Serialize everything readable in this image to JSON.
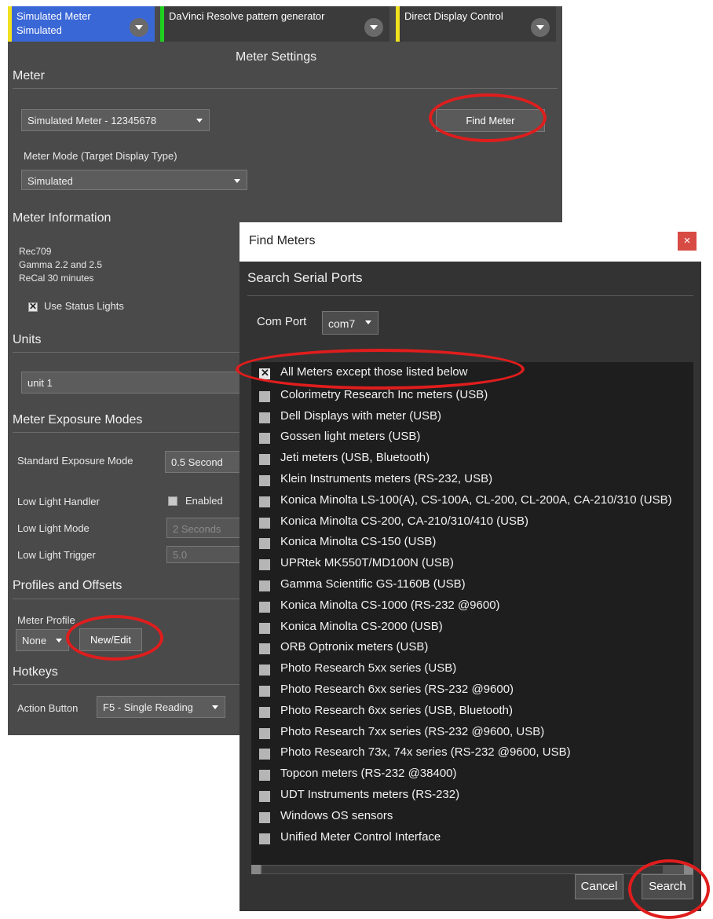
{
  "tabs": [
    {
      "label_line1": "Simulated Meter",
      "label_line2": "Simulated",
      "accent": "#f0e020",
      "bg": "#3a67d6"
    },
    {
      "label_line1": "DaVinci Resolve pattern generator",
      "label_line2": "",
      "accent": "#1fd11f",
      "bg": "#3b3b3b"
    },
    {
      "label_line1": "Direct Display Control",
      "label_line2": "",
      "accent": "#f0e020",
      "bg": "#3b3b3b"
    }
  ],
  "panel": {
    "title": "Meter Settings",
    "meter_header": "Meter",
    "meter_select": "Simulated Meter - 12345678",
    "find_meter": "Find Meter",
    "mode_label": "Meter Mode (Target Display Type)",
    "mode_select": "Simulated",
    "info_header": "Meter Information",
    "info_lines": [
      "Rec709",
      "Gamma 2.2 and 2.5",
      "ReCal 30 minutes"
    ],
    "status_lights": "Use Status Lights",
    "units_header": "Units",
    "unit_select": "unit 1",
    "exposure_header": "Meter Exposure Modes",
    "std_exposure_label": "Standard Exposure Mode",
    "std_exposure_value": "0.5 Second",
    "low_light_handler_label": "Low Light Handler",
    "enabled_label": "Enabled",
    "low_light_mode_label": "Low Light Mode",
    "low_light_mode_value": "2 Seconds",
    "low_light_trigger_label": "Low Light Trigger",
    "low_light_trigger_value": "5.0",
    "profiles_header": "Profiles and Offsets",
    "meter_profile_label": "Meter Profile",
    "profile_select": "None",
    "new_edit": "New/Edit",
    "hotkeys_header": "Hotkeys",
    "action_button_label": "Action Button",
    "action_select": "F5 - Single Reading"
  },
  "dialog": {
    "title": "Find Meters",
    "close": "×",
    "section": "Search Serial Ports",
    "com_port_label": "Com Port",
    "com_port_value": "com7",
    "meters": [
      {
        "label": "All Meters except those listed below",
        "checked": true
      },
      {
        "label": "Colorimetry Research Inc meters (USB)",
        "checked": false
      },
      {
        "label": "Dell Displays with meter (USB)",
        "checked": false
      },
      {
        "label": "Gossen light meters (USB)",
        "checked": false
      },
      {
        "label": "Jeti meters (USB, Bluetooth)",
        "checked": false
      },
      {
        "label": "Klein Instruments meters (RS-232, USB)",
        "checked": false
      },
      {
        "label": "Konica Minolta LS-100(A), CS-100A, CL-200, CL-200A, CA-210/310 (USB)",
        "checked": false
      },
      {
        "label": "Konica Minolta CS-200, CA-210/310/410 (USB)",
        "checked": false
      },
      {
        "label": "Konica Minolta CS-150 (USB)",
        "checked": false
      },
      {
        "label": "UPRtek MK550T/MD100N (USB)",
        "checked": false
      },
      {
        "label": "Gamma Scientific GS-1160B (USB)",
        "checked": false
      },
      {
        "label": "Konica Minolta CS-1000 (RS-232 @9600)",
        "checked": false
      },
      {
        "label": "Konica Minolta CS-2000 (USB)",
        "checked": false
      },
      {
        "label": "ORB Optronix meters (USB)",
        "checked": false
      },
      {
        "label": "Photo Research 5xx series (USB)",
        "checked": false
      },
      {
        "label": "Photo Research 6xx series (RS-232 @9600)",
        "checked": false
      },
      {
        "label": "Photo Research 6xx series (USB, Bluetooth)",
        "checked": false
      },
      {
        "label": "Photo Research 7xx series (RS-232 @9600, USB)",
        "checked": false
      },
      {
        "label": "Photo Research 73x, 74x series (RS-232 @9600, USB)",
        "checked": false
      },
      {
        "label": "Topcon meters (RS-232 @38400)",
        "checked": false
      },
      {
        "label": "UDT Instruments meters (RS-232)",
        "checked": false
      },
      {
        "label": "Windows OS sensors",
        "checked": false
      },
      {
        "label": "Unified Meter Control Interface",
        "checked": false
      }
    ],
    "cancel": "Cancel",
    "search": "Search"
  },
  "colors": {
    "annotation_ring": "#e01d1d",
    "close_button": "#d84b45"
  }
}
